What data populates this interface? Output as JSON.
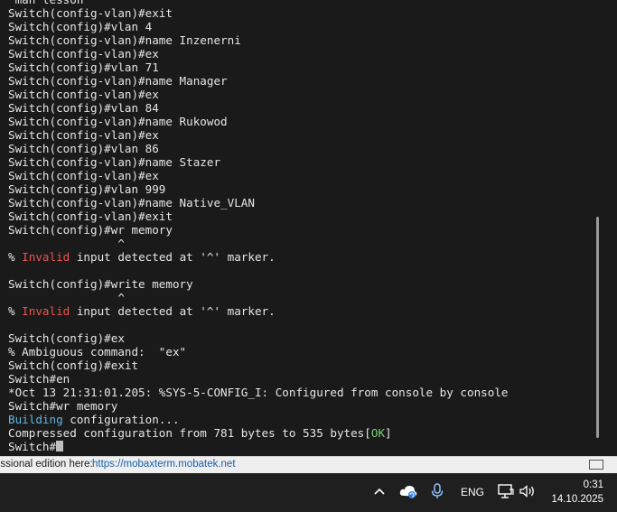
{
  "terminal": {
    "lines": [
      [
        {
          "t": " man lesson"
        }
      ],
      [
        {
          "t": "Switch(config-vlan)#exit"
        }
      ],
      [
        {
          "t": "Switch(config)#vlan 4"
        }
      ],
      [
        {
          "t": "Switch(config-vlan)#name Inzenerni"
        }
      ],
      [
        {
          "t": "Switch(config-vlan)#ex"
        }
      ],
      [
        {
          "t": "Switch(config)#vlan 71"
        }
      ],
      [
        {
          "t": "Switch(config-vlan)#name Manager"
        }
      ],
      [
        {
          "t": "Switch(config-vlan)#ex"
        }
      ],
      [
        {
          "t": "Switch(config)#vlan 84"
        }
      ],
      [
        {
          "t": "Switch(config-vlan)#name Rukowod"
        }
      ],
      [
        {
          "t": "Switch(config-vlan)#ex"
        }
      ],
      [
        {
          "t": "Switch(config)#vlan 86"
        }
      ],
      [
        {
          "t": "Switch(config-vlan)#name Stazer"
        }
      ],
      [
        {
          "t": "Switch(config-vlan)#ex"
        }
      ],
      [
        {
          "t": "Switch(config)#vlan 999"
        }
      ],
      [
        {
          "t": "Switch(config-vlan)#name Native_VLAN"
        }
      ],
      [
        {
          "t": "Switch(config-vlan)#exit"
        }
      ],
      [
        {
          "t": "Switch(config)#wr memory"
        }
      ],
      [
        {
          "t": "                ^"
        }
      ],
      [
        {
          "t": "% "
        },
        {
          "t": "Invalid",
          "c": "red"
        },
        {
          "t": " input detected at '^' marker."
        }
      ],
      [
        {
          "t": ""
        }
      ],
      [
        {
          "t": "Switch(config)#write memory"
        }
      ],
      [
        {
          "t": "                ^"
        }
      ],
      [
        {
          "t": "% "
        },
        {
          "t": "Invalid",
          "c": "red"
        },
        {
          "t": " input detected at '^' marker."
        }
      ],
      [
        {
          "t": ""
        }
      ],
      [
        {
          "t": "Switch(config)#ex"
        }
      ],
      [
        {
          "t": "% Ambiguous command:  \"ex\""
        }
      ],
      [
        {
          "t": "Switch(config)#exit"
        }
      ],
      [
        {
          "t": "Switch#en"
        }
      ],
      [
        {
          "t": "*Oct 13 21:31:01.205: %SYS-5-CONFIG_I: Configured from console by console"
        }
      ],
      [
        {
          "t": "Switch#wr memory"
        }
      ],
      [
        {
          "t": "Building",
          "c": "blue"
        },
        {
          "t": " configuration..."
        }
      ],
      [
        {
          "t": "Compressed configuration from 781 bytes to 535 bytes["
        },
        {
          "t": "OK",
          "c": "green"
        },
        {
          "t": "]"
        }
      ],
      [
        {
          "t": "Switch#"
        }
      ]
    ]
  },
  "status_bar": {
    "text": "essional edition here:",
    "link": "https://mobaxterm.mobatek.net"
  },
  "taskbar": {
    "icons": [
      "chevron-up-icon",
      "cloud-sync-icon",
      "microphone-icon",
      "network-icon",
      "speaker-icon"
    ],
    "language": "ENG",
    "time": "0:31",
    "date": "14.10.2025"
  },
  "colors": {
    "terminal_bg": "#1a1a1a",
    "terminal_fg": "#e6e6e6",
    "error_red": "#ef5350",
    "info_blue": "#5fb4e6",
    "ok_green": "#7ccf7c",
    "link_blue": "#1a5ea8"
  }
}
